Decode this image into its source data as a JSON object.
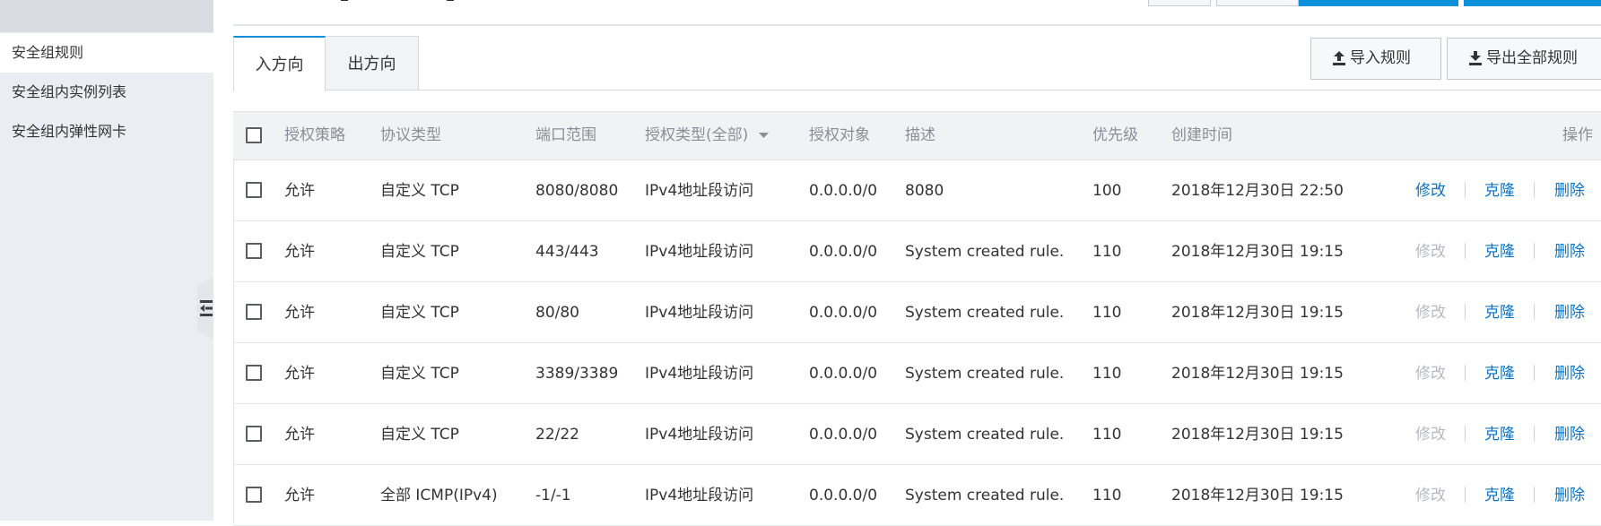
{
  "sidebar": {
    "items": [
      {
        "label": "安全组规则",
        "active": true
      },
      {
        "label": "安全组内实例列表",
        "active": false
      },
      {
        "label": "安全组内弹性网卡",
        "active": false
      }
    ]
  },
  "tabs": [
    {
      "label": "入方向",
      "active": true
    },
    {
      "label": "出方向",
      "active": false
    }
  ],
  "actions": {
    "import_label": "导入规则",
    "export_label": "导出全部规则"
  },
  "table": {
    "headers": {
      "policy": "授权策略",
      "protocol": "协议类型",
      "port": "端口范围",
      "auth_type": "授权类型(全部)",
      "target": "授权对象",
      "description": "描述",
      "priority": "优先级",
      "created": "创建时间",
      "ops": "操作"
    },
    "ops_labels": {
      "edit": "修改",
      "clone": "克隆",
      "delete": "删除"
    },
    "rows": [
      {
        "policy": "允许",
        "protocol": "自定义 TCP",
        "port": "8080/8080",
        "auth_type": "IPv4地址段访问",
        "target": "0.0.0.0/0",
        "description": "8080",
        "priority": "100",
        "created": "2018年12月30日 22:50",
        "edit_enabled": true
      },
      {
        "policy": "允许",
        "protocol": "自定义 TCP",
        "port": "443/443",
        "auth_type": "IPv4地址段访问",
        "target": "0.0.0.0/0",
        "description": "System created rule.",
        "priority": "110",
        "created": "2018年12月30日 19:15",
        "edit_enabled": false
      },
      {
        "policy": "允许",
        "protocol": "自定义 TCP",
        "port": "80/80",
        "auth_type": "IPv4地址段访问",
        "target": "0.0.0.0/0",
        "description": "System created rule.",
        "priority": "110",
        "created": "2018年12月30日 19:15",
        "edit_enabled": false
      },
      {
        "policy": "允许",
        "protocol": "自定义 TCP",
        "port": "3389/3389",
        "auth_type": "IPv4地址段访问",
        "target": "0.0.0.0/0",
        "description": "System created rule.",
        "priority": "110",
        "created": "2018年12月30日 19:15",
        "edit_enabled": false
      },
      {
        "policy": "允许",
        "protocol": "自定义 TCP",
        "port": "22/22",
        "auth_type": "IPv4地址段访问",
        "target": "0.0.0.0/0",
        "description": "System created rule.",
        "priority": "110",
        "created": "2018年12月30日 19:15",
        "edit_enabled": false
      },
      {
        "policy": "允许",
        "protocol": "全部 ICMP(IPv4)",
        "port": "-1/-1",
        "auth_type": "IPv4地址段访问",
        "target": "0.0.0.0/0",
        "description": "System created rule.",
        "priority": "110",
        "created": "2018年12月30日 19:15",
        "edit_enabled": false
      }
    ]
  },
  "colors": {
    "accent": "#0b8fd8",
    "link": "#0b72c2",
    "disabled": "#b6babf",
    "sidebar_bg": "#eaedf1"
  },
  "icons": {
    "import": "upload-icon",
    "export": "download-icon",
    "sort": "caret-down-icon",
    "collapse": "collapse-sidebar-icon"
  }
}
